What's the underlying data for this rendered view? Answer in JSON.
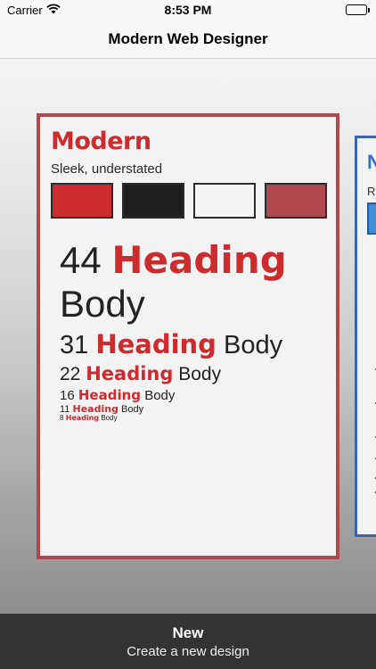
{
  "status_bar": {
    "carrier": "Carrier",
    "wifi_icon": "wifi-icon",
    "time": "8:53 PM",
    "battery_icon": "battery-icon"
  },
  "nav": {
    "title": "Modern Web Designer"
  },
  "cards": [
    {
      "name": "Modern",
      "tagline": "Sleek, understated",
      "border_color": "#b0494e",
      "swatches": [
        "#cd2b2d",
        "#1f1f1f",
        "#f5f5f5",
        "#b0494e"
      ],
      "heading_color": "#cd2b2d",
      "samples": [
        {
          "size": "44",
          "heading": "Heading",
          "body": "Body"
        },
        {
          "size": "31",
          "heading": "Heading",
          "body": "Body"
        },
        {
          "size": "22",
          "heading": "Heading",
          "body": "Body"
        },
        {
          "size": "16",
          "heading": "Heading",
          "body": "Body"
        },
        {
          "size": "11",
          "heading": "Heading",
          "body": "Body"
        },
        {
          "size": "8",
          "heading": "Heading",
          "body": "Body"
        }
      ]
    },
    {
      "name_partial": "N",
      "tagline_partial": "R",
      "border_color": "#3d63b5",
      "accent_color": "#3f8fd8"
    }
  ],
  "bottom_bar": {
    "title": "New",
    "subtitle": "Create a new design"
  }
}
